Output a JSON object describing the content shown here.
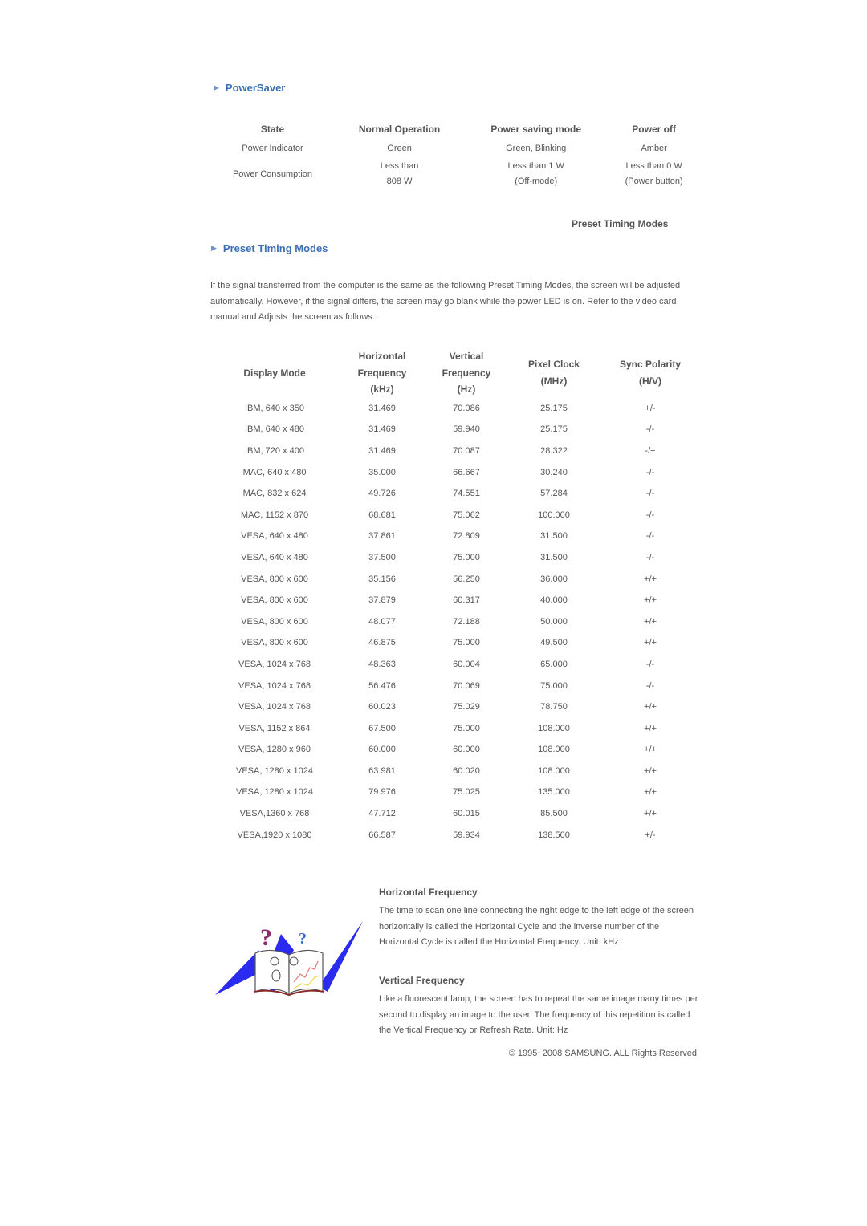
{
  "powersaver": {
    "heading": "PowerSaver",
    "bullet_icon": "chevron-right-icon",
    "columns": [
      "State",
      "Normal Operation",
      "Power saving mode",
      "Power off"
    ],
    "rows": [
      {
        "state": "Power Indicator",
        "normal": "Green",
        "saving": "Green, Blinking",
        "off": "Amber"
      },
      {
        "state": "Power Consumption",
        "normal_line1": "Less than",
        "normal_line2": "808 W",
        "saving_line1": "Less than 1 W",
        "saving_line2": "(Off-mode)",
        "off_line1": "Less than 0 W",
        "off_line2": "(Power button)"
      }
    ]
  },
  "preset": {
    "right_title": "Preset Timing Modes",
    "heading": "Preset Timing Modes",
    "bullet_icon": "chevron-right-icon",
    "intro": "If the signal transferred from the computer is the same as the following Preset Timing Modes, the screen will be adjusted automatically. However, if the signal differs, the screen may go blank while the power LED is on. Refer to the video card manual and Adjusts the screen as follows.",
    "columns": {
      "display_mode": "Display Mode",
      "hfreq": [
        "Horizontal",
        "Frequency",
        "(kHz)"
      ],
      "vfreq": [
        "Vertical",
        "Frequency",
        "(Hz)"
      ],
      "pixel_clock": [
        "Pixel Clock",
        "(MHz)"
      ],
      "sync": [
        "Sync Polarity",
        "(H/V)"
      ]
    },
    "rows": [
      [
        "IBM, 640 x 350",
        "31.469",
        "70.086",
        "25.175",
        "+/-"
      ],
      [
        "IBM, 640 x 480",
        "31.469",
        "59.940",
        "25.175",
        "-/-"
      ],
      [
        "IBM, 720 x 400",
        "31.469",
        "70.087",
        "28.322",
        "-/+"
      ],
      [
        "MAC, 640 x 480",
        "35.000",
        "66.667",
        "30.240",
        "-/-"
      ],
      [
        "MAC, 832 x 624",
        "49.726",
        "74.551",
        "57.284",
        "-/-"
      ],
      [
        "MAC, 1152 x 870",
        "68.681",
        "75.062",
        "100.000",
        "-/-"
      ],
      [
        "VESA, 640 x 480",
        "37.861",
        "72.809",
        "31.500",
        "-/-"
      ],
      [
        "VESA, 640 x 480",
        "37.500",
        "75.000",
        "31.500",
        "-/-"
      ],
      [
        "VESA, 800 x 600",
        "35.156",
        "56.250",
        "36.000",
        "+/+"
      ],
      [
        "VESA, 800 x 600",
        "37.879",
        "60.317",
        "40.000",
        "+/+"
      ],
      [
        "VESA, 800 x 600",
        "48.077",
        "72.188",
        "50.000",
        "+/+"
      ],
      [
        "VESA, 800 x 600",
        "46.875",
        "75.000",
        "49.500",
        "+/+"
      ],
      [
        "VESA, 1024 x 768",
        "48.363",
        "60.004",
        "65.000",
        "-/-"
      ],
      [
        "VESA, 1024 x 768",
        "56.476",
        "70.069",
        "75.000",
        "-/-"
      ],
      [
        "VESA, 1024 x 768",
        "60.023",
        "75.029",
        "78.750",
        "+/+"
      ],
      [
        "VESA, 1152 x 864",
        "67.500",
        "75.000",
        "108.000",
        "+/+"
      ],
      [
        "VESA, 1280 x 960",
        "60.000",
        "60.000",
        "108.000",
        "+/+"
      ],
      [
        "VESA, 1280 x 1024",
        "63.981",
        "60.020",
        "108.000",
        "+/+"
      ],
      [
        "VESA, 1280 x 1024",
        "79.976",
        "75.025",
        "135.000",
        "+/+"
      ],
      [
        "VESA,1360 x 768",
        "47.712",
        "60.015",
        "85.500",
        "+/+"
      ],
      [
        "VESA,1920 x 1080",
        "66.587",
        "59.934",
        "138.500",
        "+/-"
      ]
    ]
  },
  "definitions": {
    "illustration": "confused-book-reader-illustration",
    "horizontal": {
      "title": "Horizontal Frequency",
      "text": "The time to scan one line connecting the right edge to the left edge of the screen horizontally is called the Horizontal Cycle and the inverse number of the Horizontal Cycle is called the Horizontal Frequency. Unit: kHz"
    },
    "vertical": {
      "title": "Vertical Frequency",
      "text": "Like a fluorescent lamp, the screen has to repeat the same image many times per second to display an image to the user. The frequency of this repetition is called the Vertical Frequency or Refresh Rate. Unit: Hz"
    }
  },
  "footer": {
    "copyright": "© 1995~2008 SAMSUNG. ALL Rights Reserved"
  },
  "colors": {
    "heading_blue": "#3a6fb5",
    "text_gray": "#555555",
    "illustration_blue": "#2b2bf0"
  }
}
